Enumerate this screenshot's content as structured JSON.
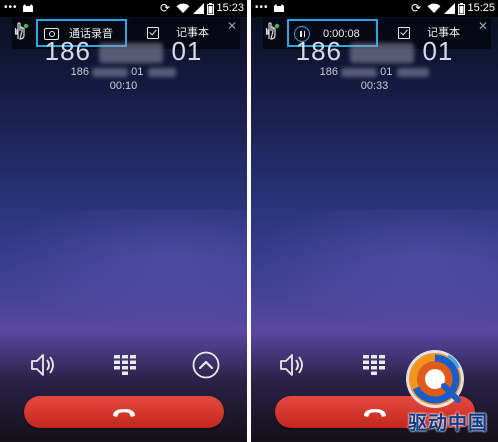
{
  "colors": {
    "highlight_border": "#2aa8e6",
    "end_call_red": "#d63328",
    "watermark_blue": "#0a3a8a"
  },
  "screens": [
    {
      "status": {
        "time": "15:23"
      },
      "record_bar": {
        "mode": "idle",
        "record_label": "通话录音",
        "note_label": "记事本"
      },
      "caller": {
        "number_large_prefix": "186",
        "number_large_suffix": "01",
        "number_small_prefix": "186",
        "number_small_suffix": "01",
        "duration": "00:10"
      },
      "controls": [
        "speaker-icon",
        "dialpad-icon",
        "chevron-up-icon"
      ]
    },
    {
      "status": {
        "time": "15:25"
      },
      "record_bar": {
        "mode": "recording",
        "record_timer": "0:00:08",
        "note_label": "记事本"
      },
      "caller": {
        "number_large_prefix": "186",
        "number_large_suffix": "01",
        "number_small_prefix": "186",
        "number_small_suffix": "01",
        "duration": "00:33"
      },
      "controls": [
        "speaker-icon",
        "dialpad-icon"
      ]
    }
  ],
  "watermark": {
    "text": "驱动中国"
  }
}
